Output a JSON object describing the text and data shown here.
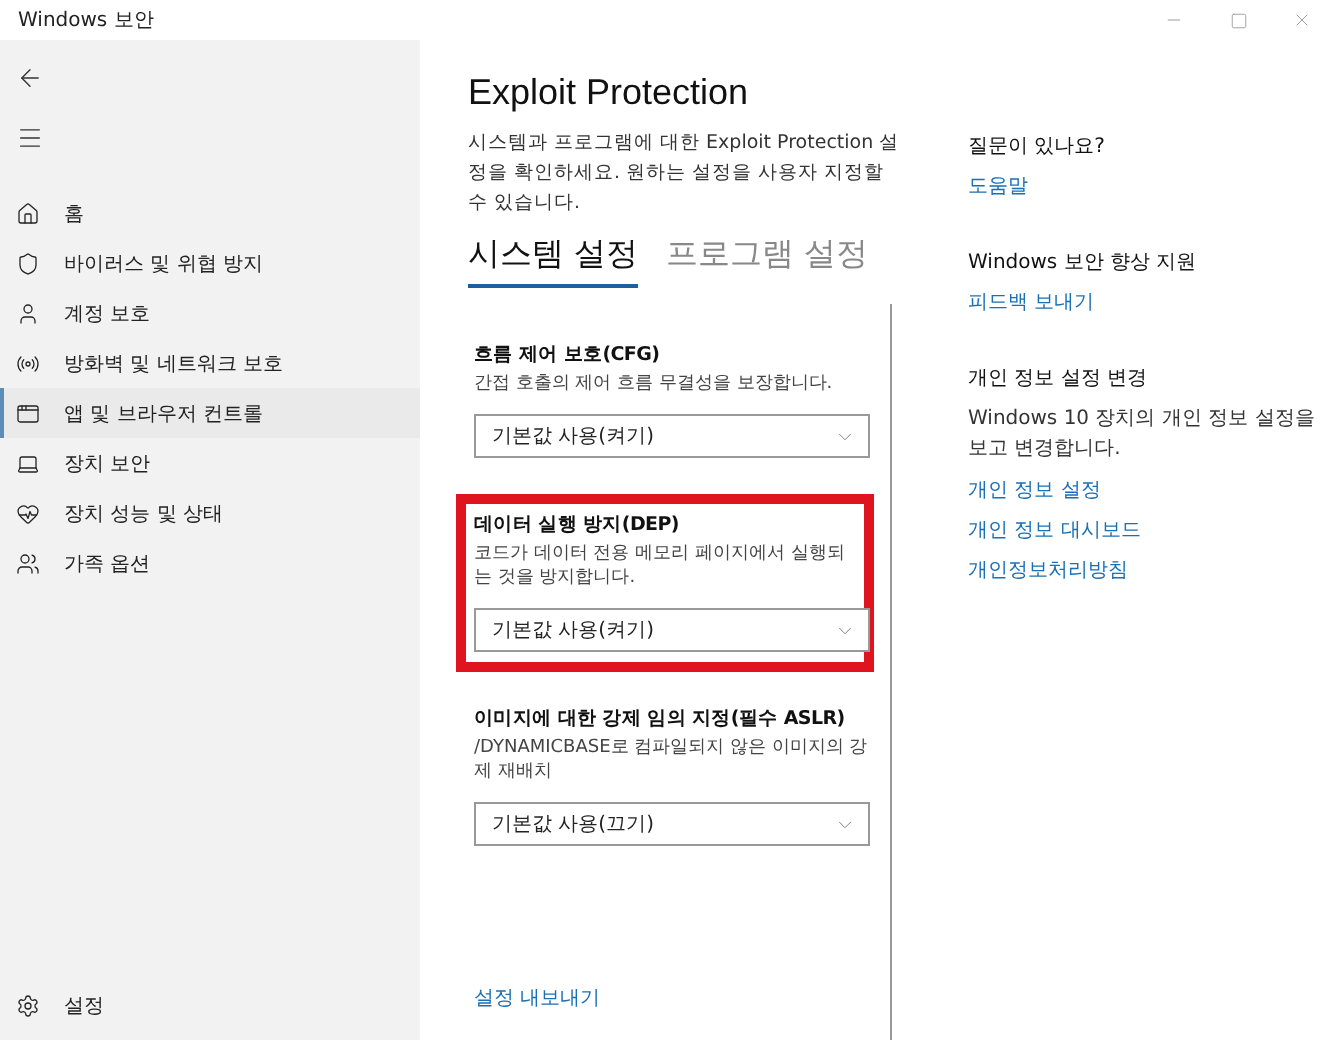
{
  "window": {
    "title": "Windows 보안"
  },
  "sidebar": {
    "items": [
      {
        "label": "홈",
        "selected": false
      },
      {
        "label": "바이러스 및 위협 방지",
        "selected": false
      },
      {
        "label": "계정 보호",
        "selected": false
      },
      {
        "label": "방화벽 및 네트워크 보호",
        "selected": false
      },
      {
        "label": "앱 및 브라우저 컨트롤",
        "selected": true
      },
      {
        "label": "장치 보안",
        "selected": false
      },
      {
        "label": "장치 성능 및 상태",
        "selected": false
      },
      {
        "label": "가족 옵션",
        "selected": false
      }
    ],
    "settings": "설정"
  },
  "main": {
    "title": "Exploit Protection",
    "description": "시스템과 프로그램에 대한 Exploit Protection 설정을 확인하세요. 원하는 설정을 사용자 지정할 수 있습니다.",
    "tabs": [
      {
        "label": "시스템 설정",
        "selected": true
      },
      {
        "label": "프로그램 설정",
        "selected": false
      }
    ],
    "settings": [
      {
        "title": "흐름 제어 보호(CFG)",
        "description": "간접 호출의 제어 흐름 무결성을 보장합니다.",
        "value": "기본값 사용(켜기)",
        "highlighted": false
      },
      {
        "title": "데이터 실행 방지(DEP)",
        "description": "코드가 데이터 전용 메모리 페이지에서 실행되는 것을 방지합니다.",
        "value": "기본값 사용(켜기)",
        "highlighted": true
      },
      {
        "title": "이미지에 대한 강제 임의 지정(필수 ASLR)",
        "description": "/DYNAMICBASE로 컴파일되지 않은 이미지의 강제 재배치",
        "value": "기본값 사용(끄기)",
        "highlighted": false
      }
    ],
    "export_link": "설정 내보내기"
  },
  "aside": [
    {
      "heading": "질문이 있나요?",
      "links": [
        "도움말"
      ]
    },
    {
      "heading": "Windows 보안 향상 지원",
      "links": [
        "피드백 보내기"
      ]
    },
    {
      "heading": "개인 정보 설정 변경",
      "text": "Windows 10 장치의 개인 정보 설정을 보고 변경합니다.",
      "links": [
        "개인 정보 설정",
        "개인 정보 대시보드",
        "개인정보처리방침"
      ]
    }
  ]
}
